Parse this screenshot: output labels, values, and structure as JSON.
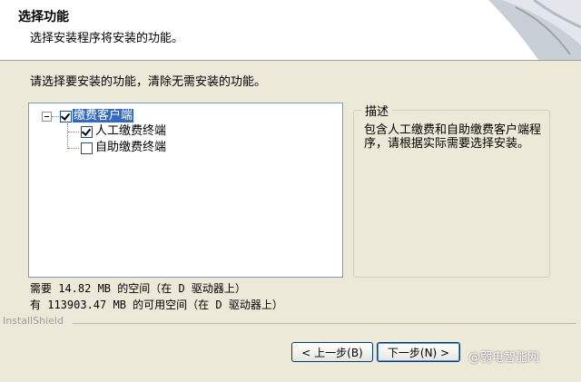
{
  "header": {
    "title": "选择功能",
    "subtitle": "选择安装程序将安装的功能。"
  },
  "main": {
    "instruction": "请选择要安装的功能，清除无需安装的功能。",
    "tree": {
      "root": {
        "label": "缴费客户端",
        "checked": true,
        "expanded": true
      },
      "children": [
        {
          "label": "人工缴费终端",
          "checked": true
        },
        {
          "label": "自助缴费终端",
          "checked": false
        }
      ]
    },
    "description": {
      "legend": "描述",
      "text": "包含人工缴费和自助缴费客户端程序，请根据实际需要选择安装。"
    },
    "space_required": "需要 14.82 MB 的空间（在 D 驱动器上）",
    "space_available": "有 113903.47 MB 的可用空间（在 D 驱动器上）"
  },
  "footer": {
    "brand": "InstallShield",
    "back_label": "< 上一步(B)",
    "next_label": "下一步(N) >",
    "watermark": "@弱电智能网"
  },
  "colors": {
    "selection": "#316ac5",
    "dialog_bg": "#ece9d8"
  }
}
